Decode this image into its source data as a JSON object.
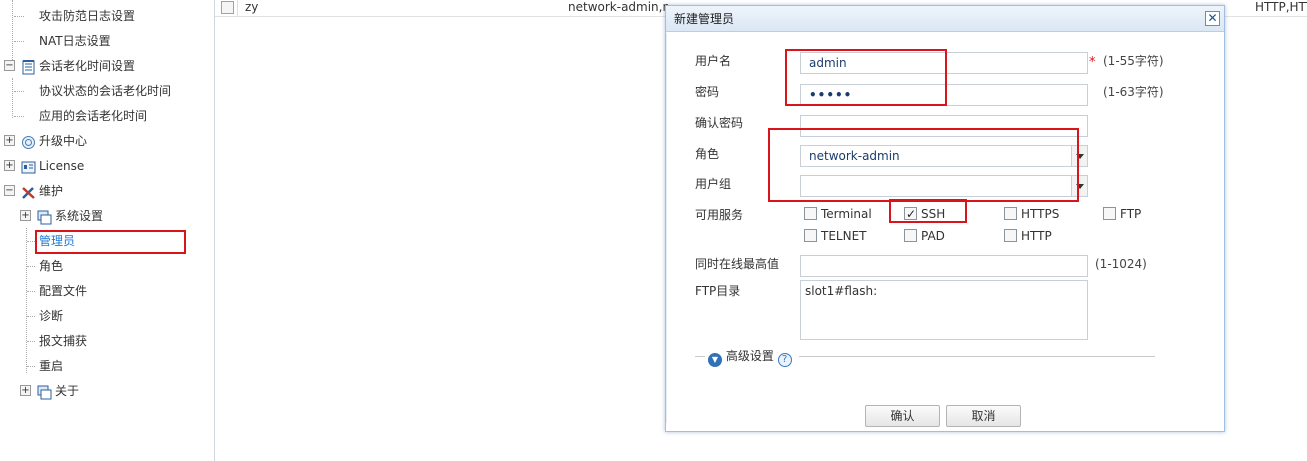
{
  "sidebar": {
    "items": [
      {
        "label": "攻击防范日志设置",
        "icon": ""
      },
      {
        "label": "NAT日志设置",
        "icon": ""
      },
      {
        "label": "会话老化时间设置",
        "icon": "notebook-icon",
        "toggle": "−"
      },
      {
        "label": "协议状态的会话老化时间",
        "icon": ""
      },
      {
        "label": "应用的会话老化时间",
        "icon": ""
      },
      {
        "label": "升级中心",
        "icon": "upgrade-icon",
        "toggle": "+"
      },
      {
        "label": "License",
        "icon": "license-icon",
        "toggle": "+"
      },
      {
        "label": "维护",
        "icon": "tools-icon",
        "toggle": "−"
      },
      {
        "label": "系统设置",
        "icon": "system-icon",
        "toggle": "+"
      },
      {
        "label": "管理员",
        "icon": "",
        "active": true
      },
      {
        "label": "角色",
        "icon": ""
      },
      {
        "label": "配置文件",
        "icon": ""
      },
      {
        "label": "诊断",
        "icon": ""
      },
      {
        "label": "报文捕获",
        "icon": ""
      },
      {
        "label": "重启",
        "icon": ""
      },
      {
        "label": "关于",
        "icon": "about-icon",
        "toggle": "+"
      }
    ]
  },
  "grid": {
    "row": {
      "name": "zy",
      "role": "network-admin,net",
      "services": "HTTP,HTTPS,SSH"
    }
  },
  "dialog": {
    "title": "新建管理员",
    "close": "✕",
    "username": {
      "label": "用户名",
      "value": "admin",
      "required": "*",
      "hint": "(1-55字符)"
    },
    "password": {
      "label": "密码",
      "value": "•••••",
      "hint": "(1-63字符)"
    },
    "confirm_password": {
      "label": "确认密码",
      "value": ""
    },
    "role": {
      "label": "角色",
      "value": "network-admin"
    },
    "user_group": {
      "label": "用户组",
      "value": ""
    },
    "services": {
      "label": "可用服务",
      "options": [
        {
          "label": "Terminal",
          "checked": false
        },
        {
          "label": "SSH",
          "checked": true
        },
        {
          "label": "HTTPS",
          "checked": false
        },
        {
          "label": "FTP",
          "checked": false
        },
        {
          "label": "TELNET",
          "checked": false
        },
        {
          "label": "PAD",
          "checked": false
        },
        {
          "label": "HTTP",
          "checked": false
        }
      ]
    },
    "max_online": {
      "label": "同时在线最高值",
      "value": "",
      "hint": "(1-1024)"
    },
    "ftp_dir": {
      "label": "FTP目录",
      "value": "slot1#flash:"
    },
    "advanced": {
      "label": "高级设置",
      "help": "?"
    },
    "ok_label": "确认",
    "cancel_label": "取消"
  },
  "colors": {
    "highlight": "#d9151b",
    "active_link": "#1e7ad6",
    "dialog_border": "#9ebfe0"
  }
}
